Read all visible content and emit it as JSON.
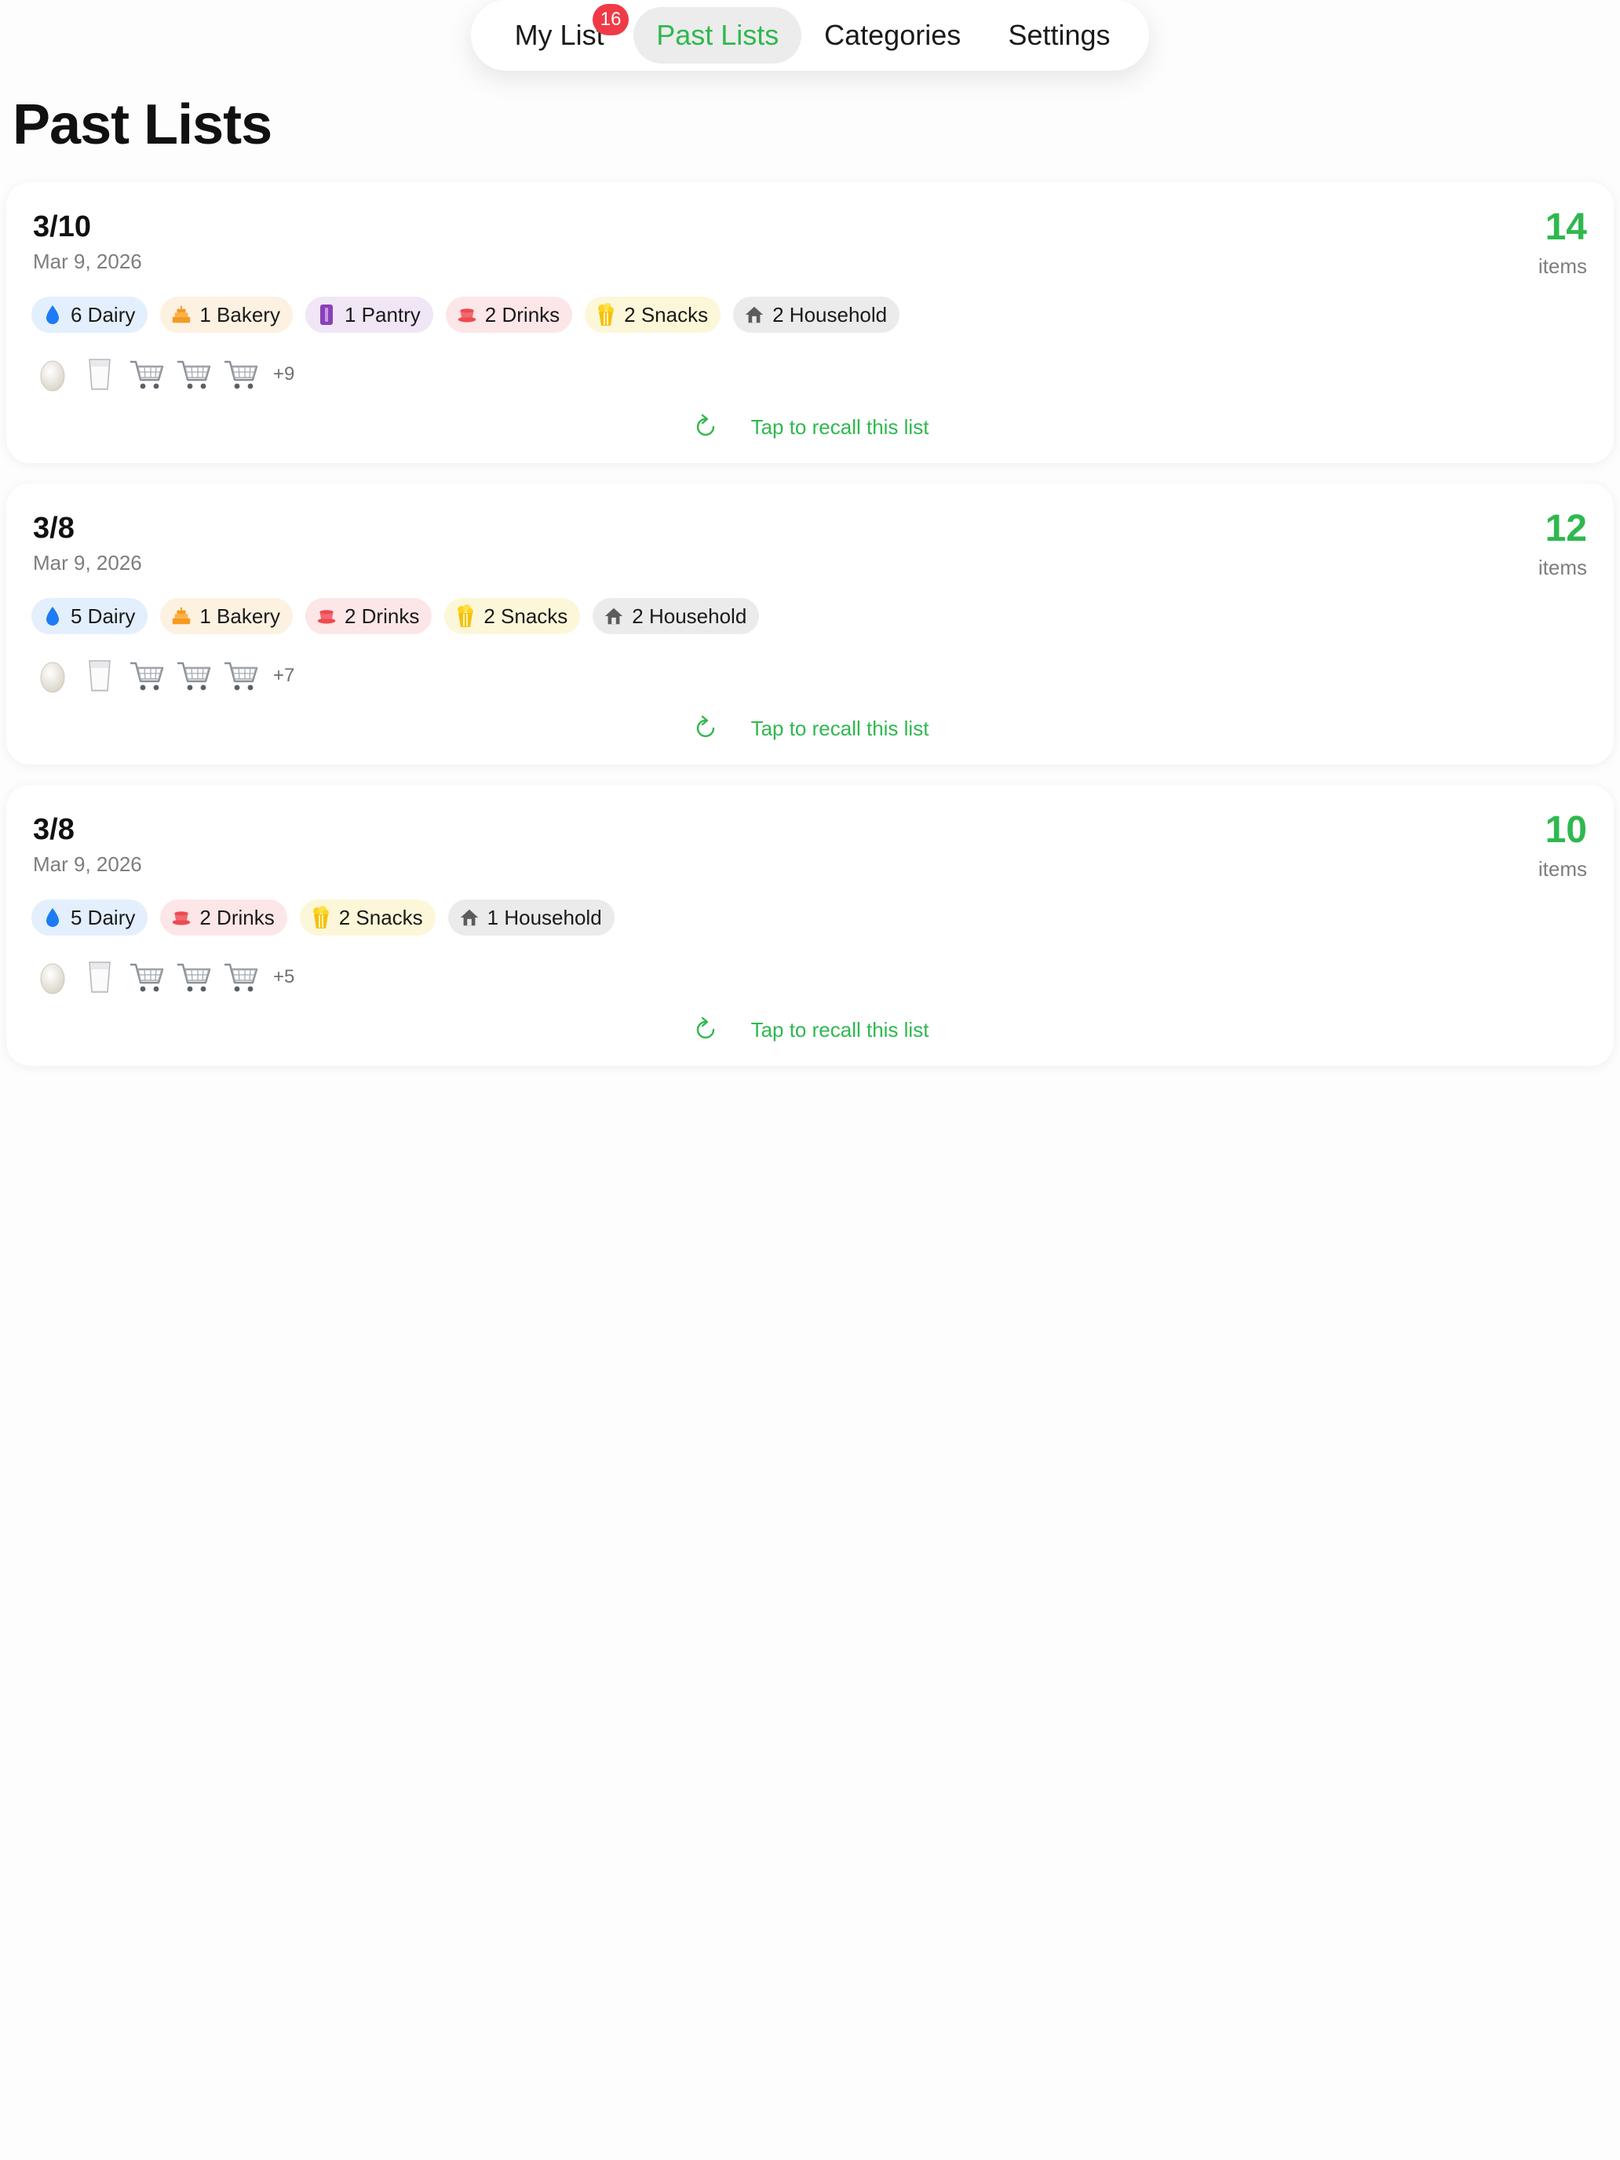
{
  "tabs": {
    "my_list": "My List",
    "my_list_badge": "16",
    "past_lists": "Past Lists",
    "categories": "Categories",
    "settings": "Settings"
  },
  "page_title": "Past Lists",
  "colors": {
    "accent": "#2fb84f",
    "badge": "#f03a47"
  },
  "cards": [
    {
      "title": "3/10",
      "date": "Mar 9, 2026",
      "count": "14",
      "count_label": "items",
      "chips": [
        {
          "label": "6 Dairy",
          "icon": "droplet-icon"
        },
        {
          "label": "1 Bakery",
          "icon": "cake-icon"
        },
        {
          "label": "1 Pantry",
          "icon": "jar-icon"
        },
        {
          "label": "2 Drinks",
          "icon": "cup-icon"
        },
        {
          "label": "2 Snacks",
          "icon": "popcorn-icon"
        },
        {
          "label": "2 Household",
          "icon": "house-icon"
        }
      ],
      "more": "+9",
      "recall": "Tap to recall this list"
    },
    {
      "title": "3/8",
      "date": "Mar 9, 2026",
      "count": "12",
      "count_label": "items",
      "chips": [
        {
          "label": "5 Dairy",
          "icon": "droplet-icon"
        },
        {
          "label": "1 Bakery",
          "icon": "cake-icon"
        },
        {
          "label": "2 Drinks",
          "icon": "cup-icon"
        },
        {
          "label": "2 Snacks",
          "icon": "popcorn-icon"
        },
        {
          "label": "2 Household",
          "icon": "house-icon"
        }
      ],
      "more": "+7",
      "recall": "Tap to recall this list"
    },
    {
      "title": "3/8",
      "date": "Mar 9, 2026",
      "count": "10",
      "count_label": "items",
      "chips": [
        {
          "label": "5 Dairy",
          "icon": "droplet-icon"
        },
        {
          "label": "2 Drinks",
          "icon": "cup-icon"
        },
        {
          "label": "2 Snacks",
          "icon": "popcorn-icon"
        },
        {
          "label": "1 Household",
          "icon": "house-icon"
        }
      ],
      "more": "+5",
      "recall": "Tap to recall this list"
    }
  ]
}
